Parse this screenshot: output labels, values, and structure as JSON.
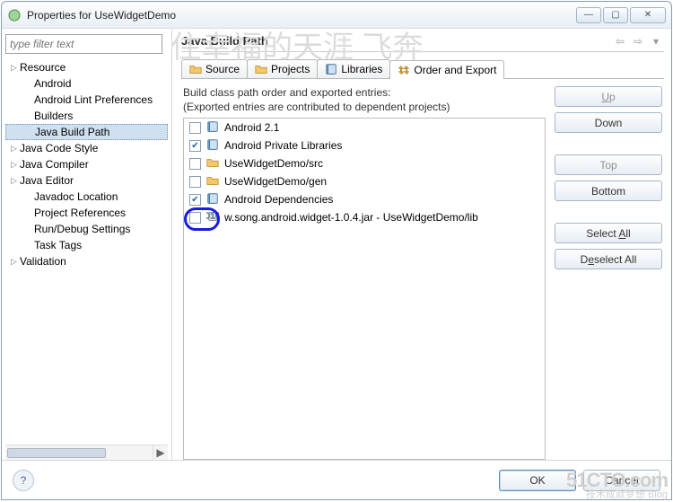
{
  "window": {
    "title": "Properties for UseWidgetDemo"
  },
  "filter_placeholder": "type filter text",
  "tree": {
    "items": [
      {
        "label": "Resource",
        "expandable": true,
        "child": false
      },
      {
        "label": "Android",
        "expandable": false,
        "child": true
      },
      {
        "label": "Android Lint Preferences",
        "expandable": false,
        "child": true
      },
      {
        "label": "Builders",
        "expandable": false,
        "child": true
      },
      {
        "label": "Java Build Path",
        "expandable": false,
        "child": true,
        "selected": true
      },
      {
        "label": "Java Code Style",
        "expandable": true,
        "child": false
      },
      {
        "label": "Java Compiler",
        "expandable": true,
        "child": false
      },
      {
        "label": "Java Editor",
        "expandable": true,
        "child": false
      },
      {
        "label": "Javadoc Location",
        "expandable": false,
        "child": true
      },
      {
        "label": "Project References",
        "expandable": false,
        "child": true
      },
      {
        "label": "Run/Debug Settings",
        "expandable": false,
        "child": true
      },
      {
        "label": "Task Tags",
        "expandable": false,
        "child": true
      },
      {
        "label": "Validation",
        "expandable": true,
        "child": false
      }
    ]
  },
  "page": {
    "title": "Java Build Path"
  },
  "tabs": [
    {
      "label": "Source",
      "icon": "folder"
    },
    {
      "label": "Projects",
      "icon": "folder"
    },
    {
      "label": "Libraries",
      "icon": "book"
    },
    {
      "label": "Order and Export",
      "icon": "order",
      "active": true
    }
  ],
  "desc": {
    "line1": "Build class path order and exported entries:",
    "line2": "(Exported entries are contributed to dependent projects)"
  },
  "entries": [
    {
      "checked": false,
      "icon": "book",
      "label": "Android 2.1"
    },
    {
      "checked": true,
      "icon": "book",
      "label": "Android Private Libraries"
    },
    {
      "checked": false,
      "icon": "folder",
      "label": "UseWidgetDemo/src"
    },
    {
      "checked": false,
      "icon": "folder",
      "label": "UseWidgetDemo/gen"
    },
    {
      "checked": true,
      "icon": "book",
      "label": "Android Dependencies"
    },
    {
      "checked": false,
      "icon": "jar",
      "label": "w.song.android.widget-1.0.4.jar - UseWidgetDemo/lib"
    }
  ],
  "buttons": {
    "up": "Up",
    "down": "Down",
    "top": "Top",
    "bottom": "Bottom",
    "select_all": "Select All",
    "deselect_all": "Deselect All",
    "ok": "OK",
    "cancel": "Cancel"
  },
  "watermark": {
    "l1": "51CTO.com",
    "l2": "技术成就梦想 Blog"
  },
  "bgtext": "住幸福的天涯 飞奔"
}
